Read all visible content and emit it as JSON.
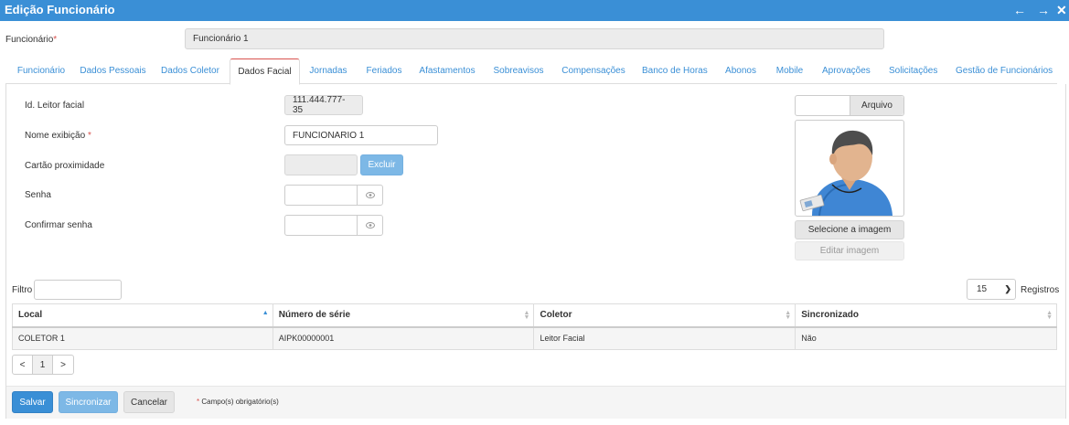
{
  "window": {
    "title": "Edição Funcionário"
  },
  "employee": {
    "label": "Funcionário",
    "value": "Funcionário 1"
  },
  "tabs": [
    {
      "label": "Funcionário"
    },
    {
      "label": "Dados Pessoais"
    },
    {
      "label": "Dados Coletor"
    },
    {
      "label": "Dados Facial"
    },
    {
      "label": "Jornadas"
    },
    {
      "label": "Feriados"
    },
    {
      "label": "Afastamentos"
    },
    {
      "label": "Sobreavisos"
    },
    {
      "label": "Compensações"
    },
    {
      "label": "Banco de Horas"
    },
    {
      "label": "Abonos"
    },
    {
      "label": "Mobile"
    },
    {
      "label": "Aprovações"
    },
    {
      "label": "Solicitações"
    },
    {
      "label": "Gestão de Funcionários"
    }
  ],
  "active_tab": "Dados Facial",
  "form": {
    "id_label": "Id. Leitor facial",
    "id_value": "111.444.777-35",
    "name_label": "Nome exibição",
    "name_value": "FUNCIONARIO 1",
    "card_label": "Cartão proximidade",
    "card_value": "",
    "delete_button": "Excluir",
    "password_label": "Senha",
    "password_value": "",
    "confirm_label": "Confirmar senha",
    "confirm_value": ""
  },
  "photo": {
    "file_button": "Arquivo",
    "select_button": "Selecione a imagem",
    "edit_button": "Editar imagem"
  },
  "filter": {
    "label": "Filtro",
    "value": ""
  },
  "page_size": {
    "value": "15",
    "label": "Registros"
  },
  "table": {
    "columns": [
      "Local",
      "Número de série",
      "Coletor",
      "Sincronizado"
    ],
    "rows": [
      [
        "COLETOR 1",
        "AIPK00000001",
        "Leitor Facial",
        "Não"
      ]
    ]
  },
  "pagination": {
    "prev": "<",
    "current": "1",
    "next": ">"
  },
  "footer": {
    "save": "Salvar",
    "sync": "Sincronizar",
    "cancel": "Cancelar",
    "required_note": "Campo(s) obrigatório(s)"
  },
  "colors": {
    "accent": "#3a8fd6",
    "required": "#d9534f"
  }
}
